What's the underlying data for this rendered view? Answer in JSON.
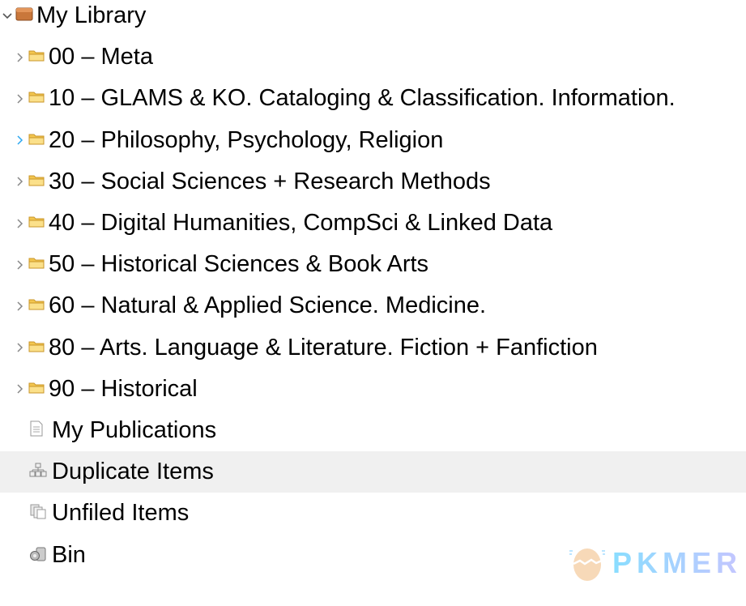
{
  "library": {
    "label": "My Library",
    "expanded": true
  },
  "collections": [
    {
      "label": "00 – Meta"
    },
    {
      "label": "10 – GLAMS & KO. Cataloging & Classification. Information."
    },
    {
      "label": "20 – Philosophy, Psychology, Religion",
      "hover": true
    },
    {
      "label": "30 – Social Sciences + Research Methods"
    },
    {
      "label": "40 – Digital Humanities, CompSci & Linked Data"
    },
    {
      "label": "50 – Historical Sciences & Book Arts"
    },
    {
      "label": "60 – Natural & Applied Science. Medicine."
    },
    {
      "label": "80 – Arts. Language & Literature. Fiction + Fanfiction"
    },
    {
      "label": "90 – Historical"
    }
  ],
  "special": [
    {
      "label": "My Publications",
      "icon": "document-icon"
    },
    {
      "label": "Duplicate Items",
      "icon": "duplicate-icon",
      "selected": true
    },
    {
      "label": "Unfiled Items",
      "icon": "unfiled-icon"
    },
    {
      "label": "Bin",
      "icon": "trash-icon"
    }
  ],
  "watermark": "PKMER",
  "colors": {
    "selected_bg": "#f0f0f0",
    "hover_chevron": "#2ea8f0",
    "chevron": "#888888",
    "folder": "#f3c64f"
  }
}
